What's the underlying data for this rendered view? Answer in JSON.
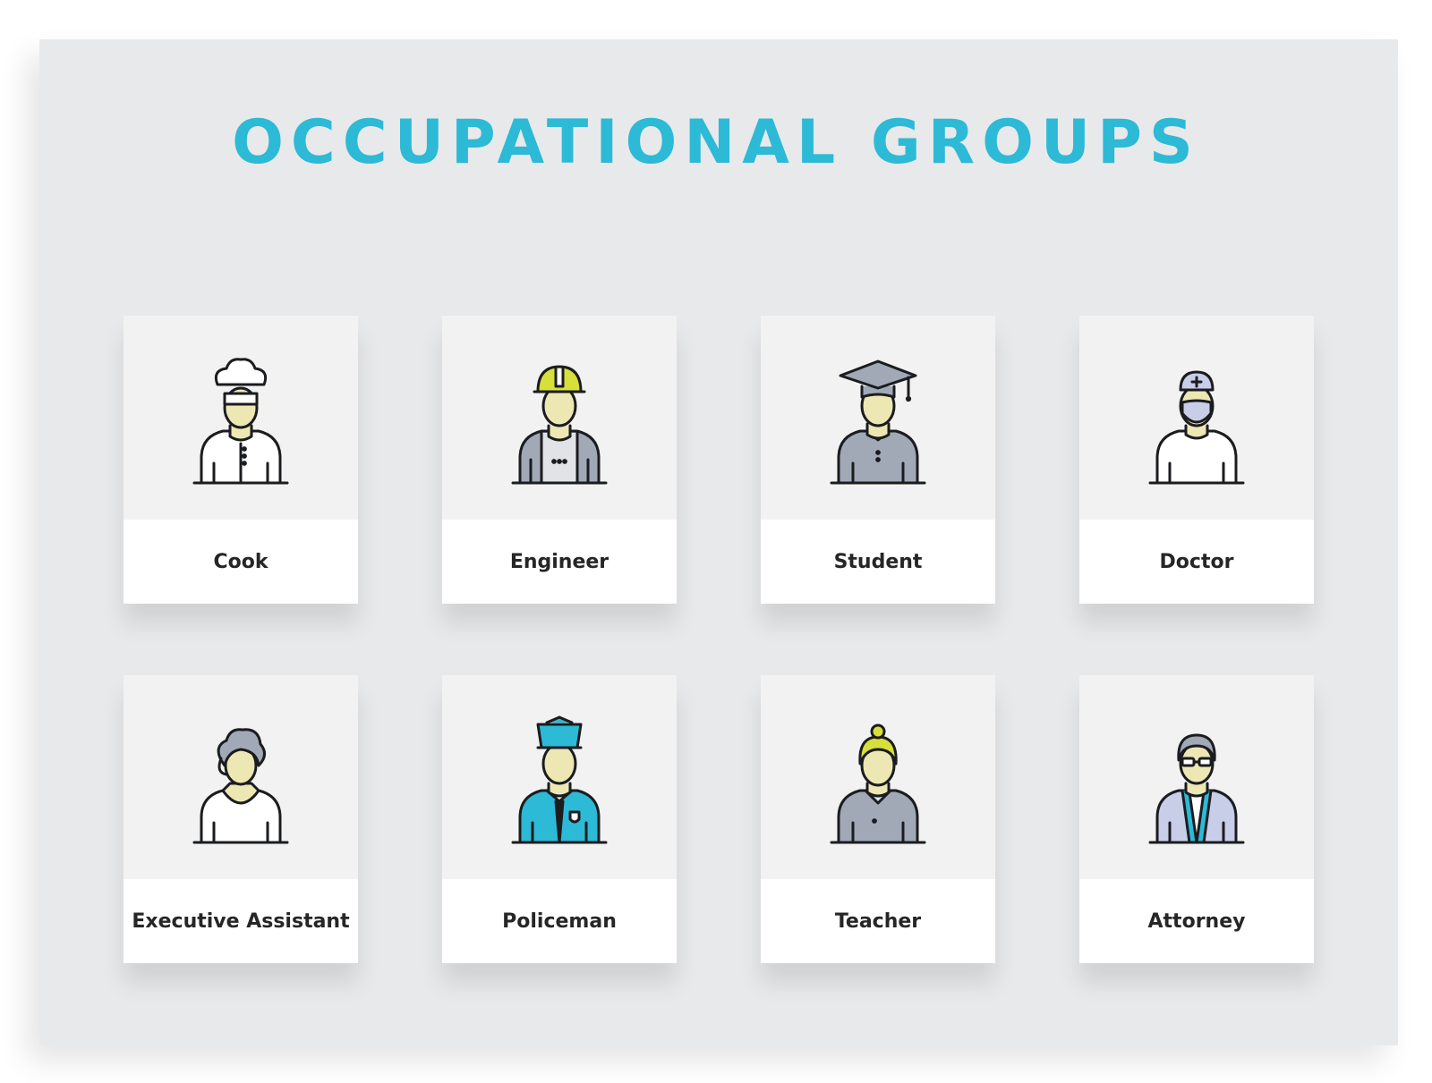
{
  "header": {
    "title": "OCCUPATIONAL GROUPS"
  },
  "colors": {
    "title": "#2cbad6",
    "stroke": "#1b1c1f",
    "skin": "#ede7b4",
    "yellow_green": "#d7df3b",
    "gray": "#a1a9b7",
    "cyan": "#2cbad6",
    "lavender": "#c8cde8"
  },
  "cards": [
    {
      "label": "Cook",
      "icon": "cook-icon"
    },
    {
      "label": "Engineer",
      "icon": "engineer-icon"
    },
    {
      "label": "Student",
      "icon": "student-icon"
    },
    {
      "label": "Doctor",
      "icon": "doctor-icon"
    },
    {
      "label": "Executive Assistant",
      "icon": "executive-assistant-icon"
    },
    {
      "label": "Policeman",
      "icon": "policeman-icon"
    },
    {
      "label": "Teacher",
      "icon": "teacher-icon"
    },
    {
      "label": "Attorney",
      "icon": "attorney-icon"
    }
  ]
}
